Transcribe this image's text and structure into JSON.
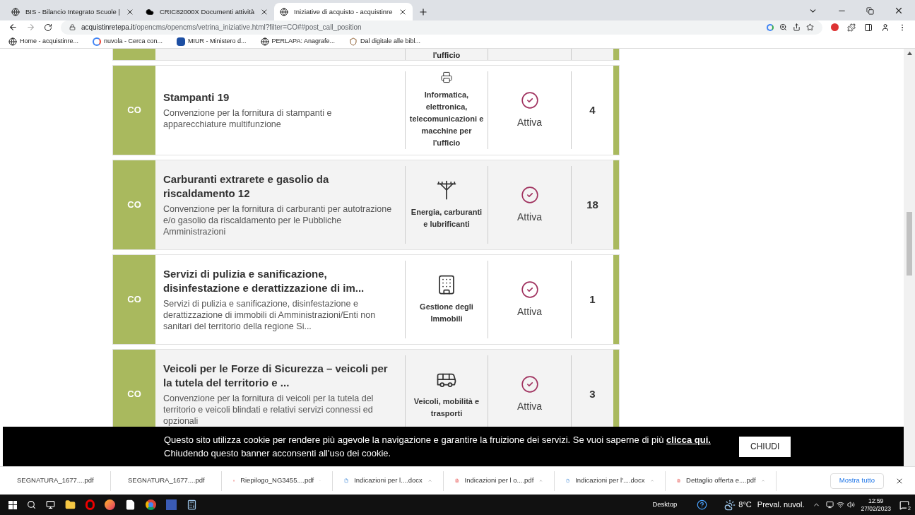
{
  "browser": {
    "tabs": [
      {
        "title": "BIS - Bilancio Integrato Scuole |",
        "kind": "globe",
        "selected": false
      },
      {
        "title": "CRIC82000X Documenti attività",
        "kind": "cloud",
        "selected": false
      },
      {
        "title": "Iniziative di acquisto - acquistinre",
        "kind": "globe",
        "selected": true
      }
    ],
    "url_host": "acquistinretepa.it",
    "url_path": "/opencms/opencms/vetrina_iniziative.html?filter=CO##post_call_position",
    "bookmarks": [
      {
        "label": "Home - acquistinre...",
        "kind": "globe"
      },
      {
        "label": "nuvola - Cerca con...",
        "kind": "google"
      },
      {
        "label": "MIUR - Ministero d...",
        "kind": "emblem"
      },
      {
        "label": "PERLAPA: Anagrafe...",
        "kind": "globe"
      },
      {
        "label": "Dal digitale alle bibl...",
        "kind": "crest"
      }
    ]
  },
  "partial_card": {
    "category": "l'ufficio"
  },
  "cards": [
    {
      "badge": "CO",
      "title": "Stampanti 19",
      "description": "Convenzione per la fornitura di stampanti e apparecchiature multifunzione",
      "kind": "printer",
      "category": "Informatica, elettronica, telecomunicazioni e macchine per l'ufficio",
      "status": "Attiva",
      "count": "4"
    },
    {
      "badge": "CO",
      "title": "Carburanti extrarete e gasolio da riscaldamento 12",
      "description": "Convenzione per la fornitura di carburanti per autotrazione e/o gasolio da riscaldamento per le Pubbliche Amministrazioni",
      "kind": "energy",
      "category": "Energia, carburanti e lubrificanti",
      "status": "Attiva",
      "count": "18"
    },
    {
      "badge": "CO",
      "title": "Servizi di pulizia e sanificazione, disinfestazione e derattizzazione di im...",
      "description": "Servizi di pulizia e sanificazione, disinfestazione e derattizzazione di immobili di Amministrazioni/Enti non sanitari del territorio della regione Si...",
      "kind": "building",
      "category": "Gestione degli Immobili",
      "status": "Attiva",
      "count": "1"
    },
    {
      "badge": "CO",
      "title": "Veicoli per le Forze di Sicurezza – veicoli per la tutela del territorio e ...",
      "description": "Convenzione per la fornitura di veicoli per la tutela del territorio e veicoli blindati e relativi servizi connessi ed opzionali",
      "kind": "vehicles",
      "category": "Veicoli, mobilità e trasporti",
      "status": "Attiva",
      "count": "3"
    }
  ],
  "cookie_banner": {
    "text": "Questo sito utilizza cookie per rendere più agevole la navigazione e garantire la fruizione dei servizi. Se vuoi saperne di più",
    "link": "clicca qui.",
    "text2": "Chiudendo questo banner acconsenti all'uso dei cookie.",
    "button": "CHIUDI"
  },
  "downloads": [
    {
      "name": "SEGNATURA_1677....pdf",
      "kind": "pdf"
    },
    {
      "name": "SEGNATURA_1677....pdf",
      "kind": "pdf"
    },
    {
      "name": "Riepilogo_NG3455....pdf",
      "kind": "pdf"
    },
    {
      "name": "Indicazioni per l....docx",
      "kind": "docx"
    },
    {
      "name": "Indicazioni per l o....pdf",
      "kind": "pdf"
    },
    {
      "name": "Indicazioni per l'....docx",
      "kind": "docx"
    },
    {
      "name": "Dettaglio offerta e....pdf",
      "kind": "pdf"
    }
  ],
  "show_all": "Mostra tutto",
  "taskbar": {
    "desktop": "Desktop",
    "temperature": "8°C",
    "weather": "Preval. nuvol.",
    "time": "12:59",
    "date": "27/02/2023",
    "notifications": "2"
  }
}
